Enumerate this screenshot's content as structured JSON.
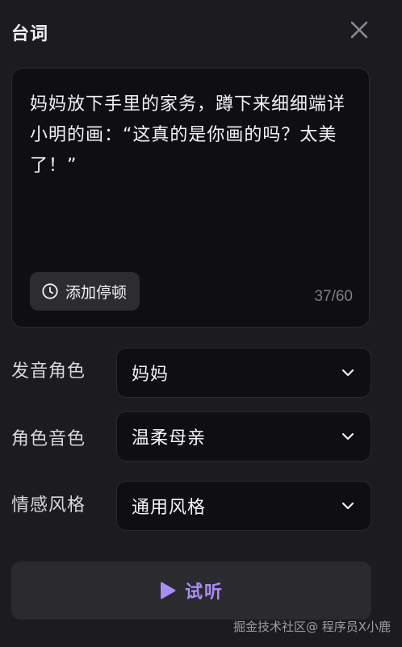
{
  "panel": {
    "title": "台词"
  },
  "editor": {
    "text": "妈妈放下手里的家务，蹲下来细细端详小明的画：“这真的是你画的吗？太美了！”",
    "pause_label": "添加停顿",
    "counter": "37/60"
  },
  "fields": [
    {
      "label": "发音角色",
      "value": "妈妈"
    },
    {
      "label": "角色音色",
      "value": "温柔母亲"
    },
    {
      "label": "情感风格",
      "value": "通用风格"
    }
  ],
  "listen_button": {
    "label": "试听"
  },
  "watermark": "掘金技术社区@ 程序员X小鹿",
  "colors": {
    "accent": "#a98cf5",
    "background": "#1c1c20",
    "field_bg": "#0f0f11"
  }
}
